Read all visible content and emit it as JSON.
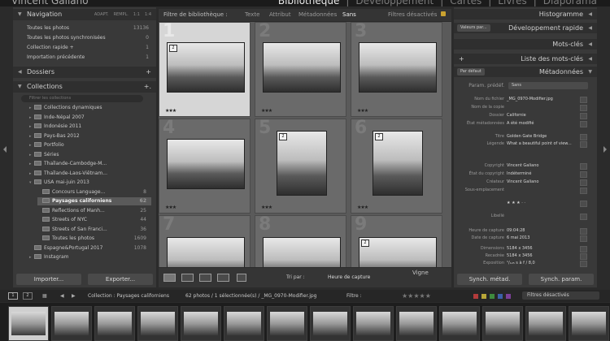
{
  "identity_plate": "Vincent Galiano",
  "modules": [
    "Bibliothèque",
    "|",
    "Développement",
    "|",
    "Cartes",
    "|",
    "Livres",
    "|",
    "Diaporama"
  ],
  "left_panel": {
    "navigation": {
      "title": "Navigation",
      "tabs": [
        "ADAPT.",
        "REMPL.",
        "1:1",
        "1:4"
      ]
    },
    "catalog": [
      {
        "label": "Toutes les photos",
        "count": "13136"
      },
      {
        "label": "Toutes les photos synchronisées",
        "count": "0"
      },
      {
        "label": "Collection rapide +",
        "count": "1"
      },
      {
        "label": "Importation précédente",
        "count": "1"
      }
    ],
    "folders": {
      "title": "Dossiers",
      "action": "+"
    },
    "collections": {
      "title": "Collections",
      "action": "+.",
      "search_placeholder": "Filtrer les collections"
    },
    "collection_items": [
      {
        "label": "Collections dynamiques",
        "count": "",
        "twisty": "▸"
      },
      {
        "label": "Inde-Népal 2007",
        "count": "",
        "twisty": "▸"
      },
      {
        "label": "Indonésie 2011",
        "count": "",
        "twisty": "▸"
      },
      {
        "label": "Pays-Bas 2012",
        "count": "",
        "twisty": "▸"
      },
      {
        "label": "Portfolio",
        "count": "",
        "twisty": "▸"
      },
      {
        "label": "Séries",
        "count": "",
        "twisty": "▸"
      },
      {
        "label": "Thaïlande-Cambodge-M...",
        "count": "",
        "twisty": "▸"
      },
      {
        "label": "Thaïlande-Laos-Viêtnam...",
        "count": "",
        "twisty": "▸"
      },
      {
        "label": "USA mai-juin 2013",
        "count": "",
        "twisty": "▾"
      },
      {
        "label": "Concours Language...",
        "count": "8",
        "twisty": ""
      },
      {
        "label": "Paysages californiens",
        "count": "62",
        "twisty": ""
      },
      {
        "label": "Reflections of Manh...",
        "count": "25",
        "twisty": ""
      },
      {
        "label": "Streets of NYC",
        "count": "44",
        "twisty": ""
      },
      {
        "label": "Streets of San Franci...",
        "count": "36",
        "twisty": ""
      },
      {
        "label": "Toutes les photos",
        "count": "1609",
        "twisty": ""
      },
      {
        "label": "Espagne&Portugal 2017",
        "count": "1078",
        "twisty": ""
      },
      {
        "label": "Instagram",
        "count": "",
        "twisty": "▸"
      }
    ],
    "import_button": "Importer...",
    "export_button": "Exporter..."
  },
  "filter_bar": {
    "label": "Filtre de bibliothèque :",
    "tabs": [
      "Texte",
      "Attribut",
      "Métadonnées",
      "Sans"
    ],
    "active": "Sans",
    "preset": "Filtres désactivés"
  },
  "grid": {
    "cells": [
      {
        "num": "1",
        "badge": "2",
        "stars": "★★★",
        "selected": true
      },
      {
        "num": "2",
        "badge": "",
        "stars": "★★★",
        "selected": false
      },
      {
        "num": "3",
        "badge": "",
        "stars": "★★★",
        "selected": false
      },
      {
        "num": "4",
        "badge": "",
        "stars": "★★★",
        "selected": false
      },
      {
        "num": "5",
        "badge": "2",
        "stars": "★★★",
        "selected": false
      },
      {
        "num": "6",
        "badge": "2",
        "stars": "★★★",
        "selected": false
      },
      {
        "num": "7",
        "badge": "",
        "stars": "",
        "selected": false
      },
      {
        "num": "8",
        "badge": "",
        "stars": "",
        "selected": false
      },
      {
        "num": "9",
        "badge": "2",
        "stars": "",
        "selected": false
      }
    ]
  },
  "toolbar": {
    "sort_label": "Tri par :",
    "sort_value": "Heure de capture",
    "vignette_label": "Vigne"
  },
  "right_panel": {
    "histogram": "Histogramme",
    "quick_develop": {
      "title": "Développement rapide",
      "preset": "Valeurs par..."
    },
    "keywords": "Mots-clés",
    "keyword_list": "Liste des mots-clés",
    "metadata": {
      "title": "Métadonnées",
      "preset_dropdown": "Par défaut",
      "preset_label": "Param. prédéf.",
      "preset_value": "Sans"
    },
    "metadata_rows": [
      {
        "key": "Nom du fichier",
        "value": "_MG_0970-Modifier.jpg"
      },
      {
        "key": "Nom de la copie",
        "value": ""
      },
      {
        "key": "Dossier",
        "value": "Californie"
      },
      {
        "key": "État métadonnées",
        "value": "A été modifié"
      },
      {
        "key": "Titre",
        "value": "Golden Gate Bridge"
      },
      {
        "key": "Légende",
        "value": "What a beautiful point of view..."
      },
      {
        "key": "Copyright",
        "value": "Vincent Galiano"
      },
      {
        "key": "État du copyright",
        "value": "Indéterminé"
      },
      {
        "key": "Créateur",
        "value": "Vincent Galiano"
      },
      {
        "key": "Sous-emplacement",
        "value": ""
      },
      {
        "key": "",
        "value": "★ ★ ★ · ·"
      },
      {
        "key": "Libellé",
        "value": ""
      },
      {
        "key": "Heure de capture",
        "value": "09:04:28"
      },
      {
        "key": "Date de capture",
        "value": "6 mai 2013"
      },
      {
        "key": "Dimensions",
        "value": "5184 x 3456"
      },
      {
        "key": "Recadrée",
        "value": "5184 x 3456"
      },
      {
        "key": "Exposition",
        "value": "¹/₁₂₅ s à f / 8,0"
      }
    ],
    "sync_metadata": "Synch. métad.",
    "sync_settings": "Synch. param."
  },
  "filmstrip_bar": {
    "pages": [
      "1",
      "2"
    ],
    "source": "Collection : Paysages californiens",
    "count": "62 photos / 1 sélectionnée(s) / _MG_0970-Modifier.jpg",
    "filter_label": "Filtre :",
    "filter_value": "Filtres désactivés"
  },
  "filmstrip_count": 14,
  "colors": {
    "background": "#2b2b2b",
    "panel": "#393939",
    "grid": "#5a5a5a",
    "selected": "#d6d6d6"
  }
}
